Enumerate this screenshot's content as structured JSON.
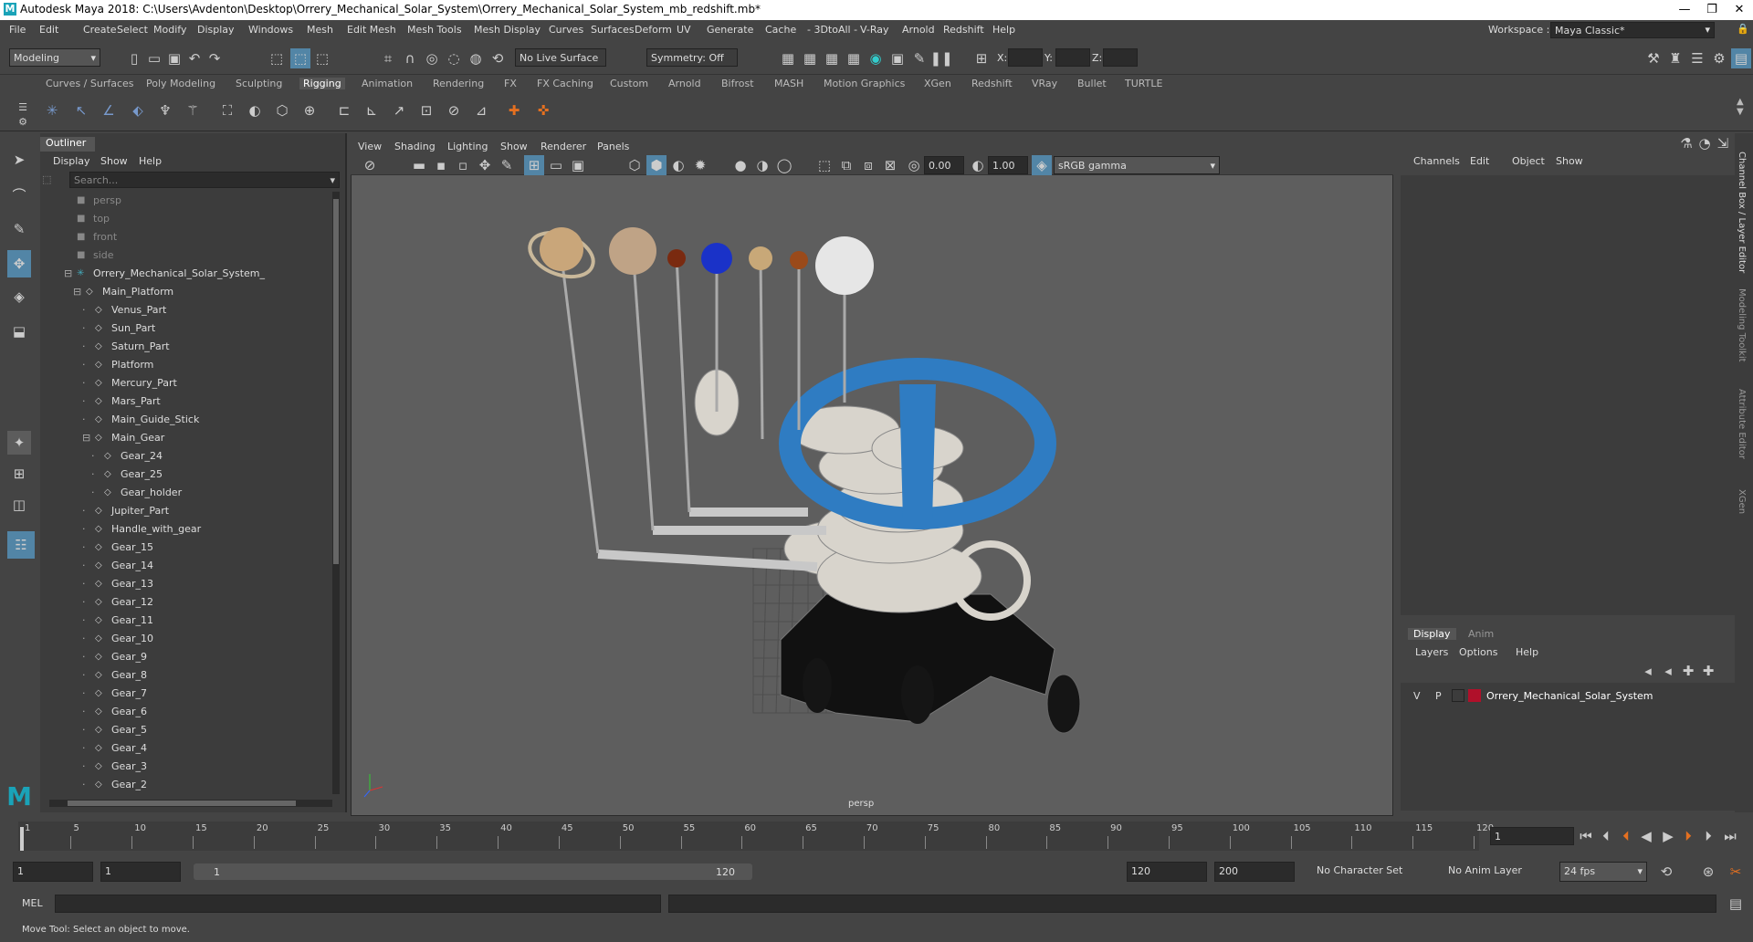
{
  "app": {
    "title": "Autodesk Maya 2018: C:\\Users\\Avdenton\\Desktop\\Orrery_Mechanical_Solar_System\\Orrery_Mechanical_Solar_System_mb_redshift.mb*",
    "logo": "M"
  },
  "menu": [
    "File",
    "Edit",
    "Create",
    "Select",
    "Modify",
    "Display",
    "Windows",
    "Mesh",
    "Edit Mesh",
    "Mesh Tools",
    "Mesh Display",
    "Curves",
    "Surfaces",
    "Deform",
    "UV",
    "Generate",
    "Cache",
    "- 3DtoAll -",
    "V-Ray",
    "Arnold",
    "Redshift",
    "Help"
  ],
  "workspace": {
    "label": "Workspace :",
    "value": "Maya Classic*"
  },
  "status": {
    "mode": "Modeling",
    "live_surface": "No Live Surface",
    "symmetry": "Symmetry: Off",
    "x_label": "X:",
    "y_label": "Y:",
    "z_label": "Z:"
  },
  "shelf_tabs": [
    "Curves / Surfaces",
    "Poly Modeling",
    "Sculpting",
    "Rigging",
    "Animation",
    "Rendering",
    "FX",
    "FX Caching",
    "Custom",
    "Arnold",
    "Bifrost",
    "MASH",
    "Motion Graphics",
    "XGen",
    "Redshift",
    "VRay",
    "Bullet",
    "TURTLE"
  ],
  "shelf_active": "Rigging",
  "outliner": {
    "title": "Outliner",
    "menu": [
      "Display",
      "Show",
      "Help"
    ],
    "search_placeholder": "Search...",
    "cameras": [
      "persp",
      "top",
      "front",
      "side"
    ],
    "root": "Orrery_Mechanical_Solar_System_",
    "main": "Main_Platform",
    "items": [
      "Venus_Part",
      "Sun_Part",
      "Saturn_Part",
      "Platform",
      "Mercury_Part",
      "Mars_Part",
      "Main_Guide_Stick",
      "Main_Gear"
    ],
    "gear_children": [
      "Gear_24",
      "Gear_25",
      "Gear_holder"
    ],
    "items2": [
      "Jupiter_Part",
      "Handle_with_gear",
      "Gear_15",
      "Gear_14",
      "Gear_13",
      "Gear_12",
      "Gear_11",
      "Gear_10",
      "Gear_9",
      "Gear_8",
      "Gear_7",
      "Gear_6",
      "Gear_5",
      "Gear_4",
      "Gear_3",
      "Gear_2"
    ]
  },
  "viewport": {
    "menu": [
      "View",
      "Shading",
      "Lighting",
      "Show",
      "Renderer",
      "Panels"
    ],
    "val1": "0.00",
    "val2": "1.00",
    "colorspace": "sRGB gamma",
    "camera": "persp"
  },
  "channel_box": {
    "menu": [
      "Channels",
      "Edit",
      "Object",
      "Show"
    ],
    "tabs": [
      "Display",
      "Anim"
    ],
    "layer_menu": [
      "Layers",
      "Options",
      "Help"
    ],
    "layer": {
      "v": "V",
      "p": "P",
      "name": "Orrery_Mechanical_Solar_System",
      "color": "#b0102a"
    },
    "side_tabs": [
      "Channel Box / Layer Editor",
      "Modeling Toolkit",
      "Attribute Editor",
      "XGen"
    ]
  },
  "timeline": {
    "ticks": [
      "1",
      "5",
      "10",
      "15",
      "20",
      "25",
      "30",
      "35",
      "40",
      "45",
      "50",
      "55",
      "60",
      "65",
      "70",
      "75",
      "80",
      "85",
      "90",
      "95",
      "100",
      "105",
      "110",
      "115",
      "120"
    ],
    "current_frame": "1"
  },
  "range": {
    "start": "1",
    "start2": "1",
    "range_start": "1",
    "range_end": "120",
    "end": "120",
    "end2": "200",
    "character_set": "No Character Set",
    "anim_layer": "No Anim Layer",
    "fps": "24 fps"
  },
  "cmd": {
    "label": "MEL"
  },
  "help": {
    "text": "Move Tool: Select an object to move."
  }
}
